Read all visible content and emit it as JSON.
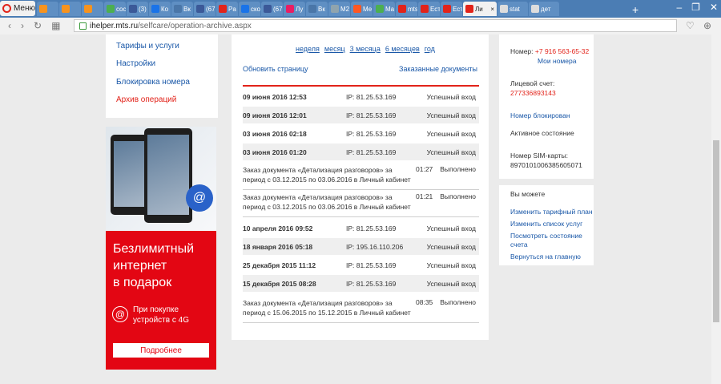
{
  "browser": {
    "menu_label": "Меню",
    "tabs": [
      {
        "label": "",
        "color": "#f7931e"
      },
      {
        "label": "",
        "color": "#f7931e"
      },
      {
        "label": "",
        "color": "#f7931e"
      },
      {
        "label": "coc",
        "color": "#4caf50"
      },
      {
        "label": "(3)",
        "color": "#3b5998"
      },
      {
        "label": "Ко",
        "color": "#1a73e8"
      },
      {
        "label": "Вк",
        "color": "#4a76a8"
      },
      {
        "label": "(67",
        "color": "#3b5998"
      },
      {
        "label": "Pa",
        "color": "#e2231a"
      },
      {
        "label": "cко",
        "color": "#1a73e8"
      },
      {
        "label": "(67",
        "color": "#3b5998"
      },
      {
        "label": "Лу",
        "color": "#e91e63"
      },
      {
        "label": "Вк",
        "color": "#4a76a8"
      },
      {
        "label": "M2",
        "color": "#90a4ae"
      },
      {
        "label": "Ме",
        "color": "#ff5722"
      },
      {
        "label": "Ma",
        "color": "#4caf50"
      },
      {
        "label": "mts",
        "color": "#e2231a"
      },
      {
        "label": "Ест",
        "color": "#e2231a"
      },
      {
        "label": "Ест",
        "color": "#e2231a"
      }
    ],
    "active_tab": "Ли",
    "after_tabs": [
      {
        "label": "stat"
      },
      {
        "label": "дет"
      }
    ],
    "new_tab": "+",
    "url_host": "ihelper.mts.ru",
    "url_path": "/selfcare/operation-archive.aspx"
  },
  "left_menu": {
    "items": [
      {
        "label": "Тарифы и услуги"
      },
      {
        "label": "Настройки"
      },
      {
        "label": "Блокировка номера"
      },
      {
        "label": "Архив операций"
      }
    ]
  },
  "ad": {
    "headline_1": "Безлимитный",
    "headline_2": "интернет",
    "headline_3": "в подарок",
    "promo_1": "При покупке",
    "promo_2": "устройств с 4G",
    "button": "Подробнее",
    "at_symbol": "@"
  },
  "main": {
    "periods": [
      "неделя",
      "месяц",
      "3 месяца",
      "6 месяцев",
      "год"
    ],
    "refresh": "Обновить страницу",
    "ordered_docs": "Заказанные документы",
    "rows": [
      {
        "date": "09 июня 2016 12:53",
        "ip": "IP: 81.25.53.169",
        "status": "Успешный вход"
      },
      {
        "date": "09 июня 2016 12:01",
        "ip": "IP: 81.25.53.169",
        "status": "Успешный вход"
      },
      {
        "date": "03 июня 2016 02:18",
        "ip": "IP: 81.25.53.169",
        "status": "Успешный вход"
      },
      {
        "date": "03 июня 2016 01:20",
        "ip": "IP: 81.25.53.169",
        "status": "Успешный вход"
      }
    ],
    "orders_1": [
      {
        "text": "Заказ документа «Детализация разговоров» за период с 03.12.2015 по 03.06.2016 в Личный кабинет",
        "time": "01:27",
        "status": "Выполнено"
      },
      {
        "text": "Заказ документа «Детализация разговоров» за период с 03.12.2015 по 03.06.2016 в Личный кабинет",
        "time": "01:21",
        "status": "Выполнено"
      }
    ],
    "rows_2": [
      {
        "date": "10 апреля 2016 09:52",
        "ip": "IP: 81.25.53.169",
        "status": "Успешный вход"
      },
      {
        "date": "18 января 2016 05:18",
        "ip": "IP: 195.16.110.206",
        "status": "Успешный вход"
      },
      {
        "date": "25 декабря 2015 11:12",
        "ip": "IP: 81.25.53.169",
        "status": "Успешный вход"
      },
      {
        "date": "15 декабря 2015 08:28",
        "ip": "IP: 81.25.53.169",
        "status": "Успешный вход"
      }
    ],
    "orders_2": [
      {
        "text": "Заказ документа «Детализация разговоров» за период с 15.06.2015 по 15.12.2015 в Личный кабинет",
        "time": "08:35",
        "status": "Выполнено"
      }
    ]
  },
  "account": {
    "number_label": "Номер:",
    "number": "+7 916 563-65-32",
    "my_numbers": "Мои номера",
    "account_label": "Лицевой счет:",
    "account_number": "277336893143",
    "blocked": "Номер блокирован",
    "state": "Активное состояние",
    "sim_label": "Номер SIM-карты:",
    "sim_number": "8970101006385605071"
  },
  "can_do": {
    "title": "Вы можете",
    "links": [
      {
        "label": "Изменить тарифный план"
      },
      {
        "label": "Изменить список услуг"
      },
      {
        "label": "Посмотреть состояние"
      },
      {
        "label": "счета"
      },
      {
        "label": "Вернуться на главную"
      }
    ]
  }
}
